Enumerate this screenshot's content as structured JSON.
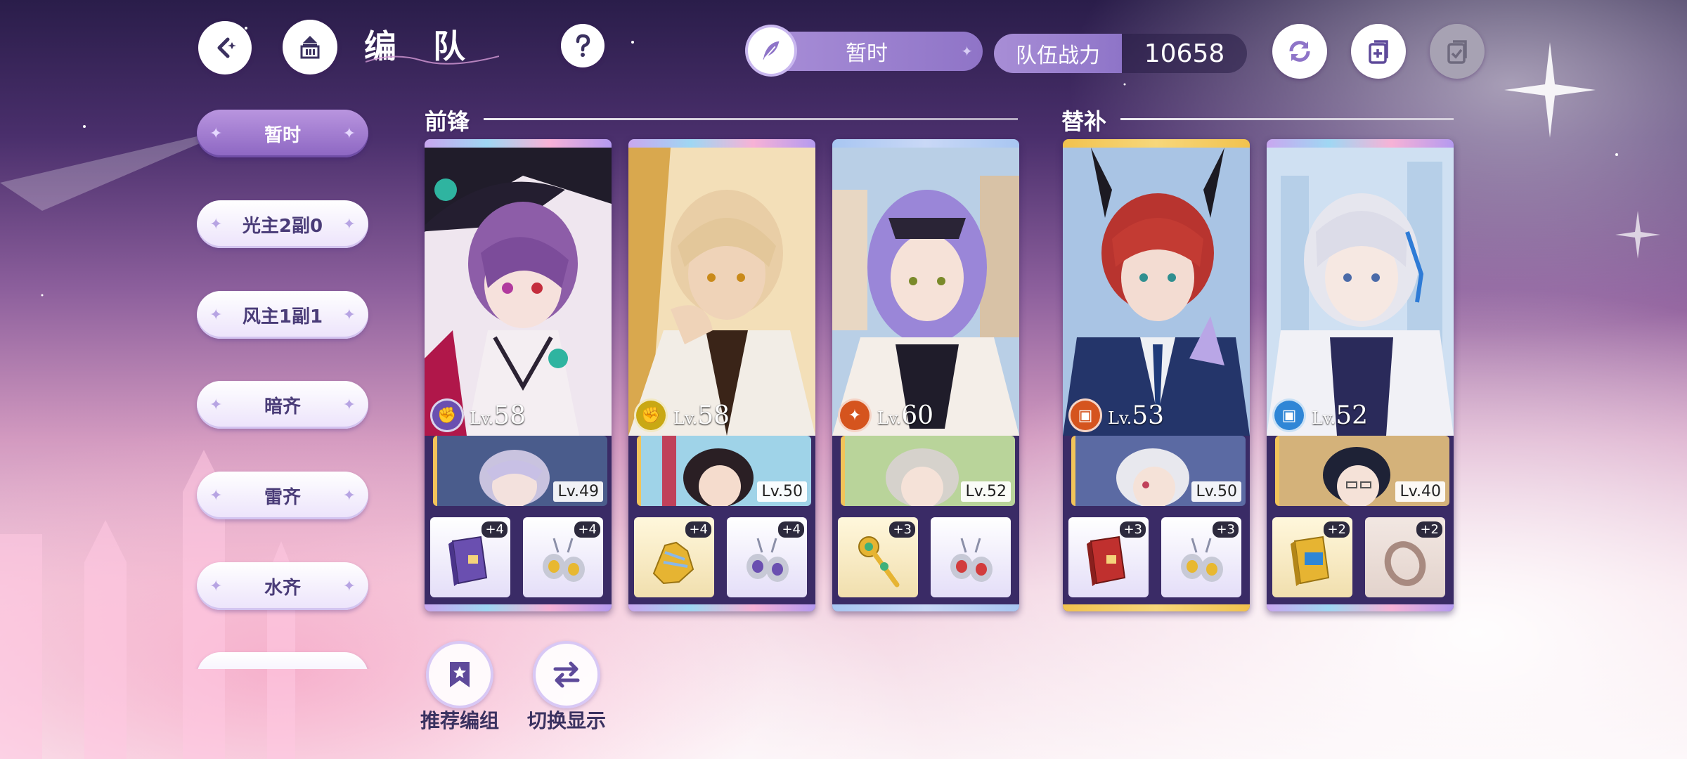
{
  "header": {
    "title": "编 队",
    "team_name": "暂时",
    "power_label": "队伍战力",
    "power_value": "10658"
  },
  "sidebar": {
    "items": [
      {
        "label": "暂时",
        "active": true
      },
      {
        "label": "光主2副0",
        "active": false
      },
      {
        "label": "风主1副1",
        "active": false
      },
      {
        "label": "暗齐",
        "active": false
      },
      {
        "label": "雷齐",
        "active": false
      },
      {
        "label": "水齐",
        "active": false
      },
      {
        "label": "",
        "active": false
      }
    ]
  },
  "sections": {
    "front": "前锋",
    "reserve": "替补"
  },
  "cards": [
    {
      "level_prefix": "Lv.",
      "level": "58",
      "element_color": "#6a4fb0",
      "element_icon": "fist-icon",
      "sub_level": "Lv.49",
      "equip": [
        {
          "plus": "+4",
          "icon": "purple-book-icon"
        },
        {
          "plus": "+4",
          "icon": "gold-earring-icon"
        }
      ]
    },
    {
      "level_prefix": "Lv.",
      "level": "58",
      "element_color": "#c9a814",
      "element_icon": "fist-icon",
      "sub_level": "Lv.50",
      "equip": [
        {
          "plus": "+4",
          "icon": "gold-gauntlet-icon"
        },
        {
          "plus": "+4",
          "icon": "purple-earring-icon"
        }
      ]
    },
    {
      "level_prefix": "Lv.",
      "level": "60",
      "element_color": "#d5541e",
      "element_icon": "staff-icon",
      "sub_level": "Lv.52",
      "equip": [
        {
          "plus": "+3",
          "icon": "gold-staff-icon"
        },
        {
          "plus": "",
          "icon": "red-earring-icon"
        }
      ]
    },
    {
      "level_prefix": "Lv.",
      "level": "53",
      "element_color": "#d5541e",
      "element_icon": "book-icon",
      "sub_level": "Lv.50",
      "equip": [
        {
          "plus": "+3",
          "icon": "red-book-icon"
        },
        {
          "plus": "+3",
          "icon": "gold-earring-icon"
        }
      ]
    },
    {
      "level_prefix": "Lv.",
      "level": "52",
      "element_color": "#2f86d6",
      "element_icon": "book-icon",
      "sub_level": "Lv.40",
      "equip": [
        {
          "plus": "+2",
          "icon": "blue-book-icon"
        },
        {
          "plus": "+2",
          "icon": "ring-icon"
        }
      ]
    }
  ],
  "bottom_buttons": {
    "recommend": "推荐编组",
    "switch_display": "切换显示"
  },
  "colors": {
    "accent": "#8e74c8",
    "card_frame": "#3a2b66"
  }
}
